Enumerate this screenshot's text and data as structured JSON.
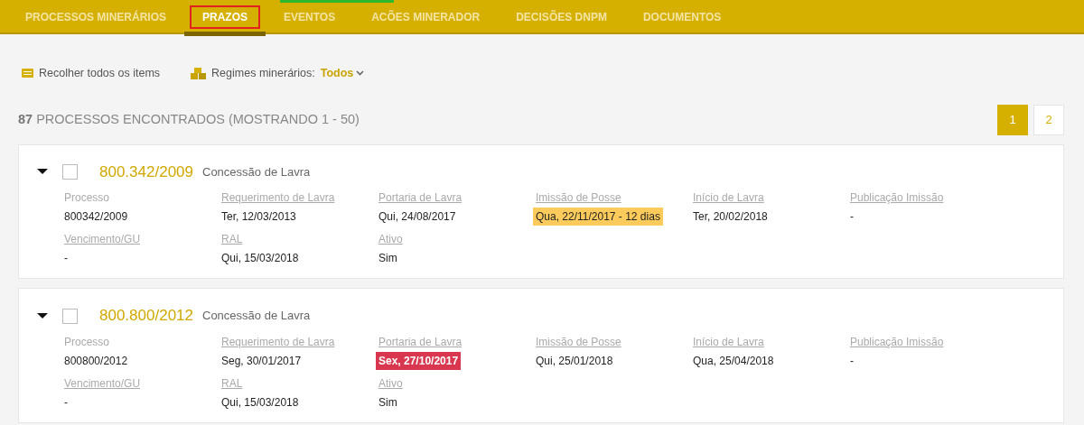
{
  "tabs": [
    {
      "label": "PROCESSOS MINERÁRIOS",
      "selected": false,
      "outlined": false
    },
    {
      "label": "PRAZOS",
      "selected": true,
      "outlined": true
    },
    {
      "label": "EVENTOS",
      "selected": false,
      "outlined": false
    },
    {
      "label": "ACÕES MINERADOR",
      "selected": false,
      "outlined": false
    },
    {
      "label": "DECISÕES DNPM",
      "selected": false,
      "outlined": false
    },
    {
      "label": "DOCUMENTOS",
      "selected": false,
      "outlined": false
    }
  ],
  "toolbar": {
    "collapse_label": "Recolher todos os items",
    "regimes_label": "Regimes minerários:",
    "regimes_value": "Todos"
  },
  "results": {
    "count": "87",
    "text": "PROCESSOS ENCONTRADOS",
    "range": "(MOSTRANDO 1 - 50)"
  },
  "pagination": [
    {
      "label": "1",
      "selected": true
    },
    {
      "label": "2",
      "selected": false
    }
  ],
  "processes": [
    {
      "number": "800.342/2009",
      "type": "Concessão de Lavra",
      "expanded": true,
      "checked": false,
      "fields": [
        {
          "label": "Processo",
          "link": false,
          "value": "800342/2009",
          "warning": false,
          "overdue": false
        },
        {
          "label": "Requerimento de Lavra",
          "link": true,
          "value": "Ter, 12/03/2013",
          "warning": false,
          "overdue": false
        },
        {
          "label": "Portaria de Lavra",
          "link": true,
          "value": "Qui, 24/08/2017",
          "warning": false,
          "overdue": false
        },
        {
          "label": "Imissão de Posse",
          "link": true,
          "value": "Qua, 22/11/2017 - 12 dias",
          "warning": true,
          "overdue": false
        },
        {
          "label": "Início de Lavra",
          "link": true,
          "value": "Ter, 20/02/2018",
          "warning": false,
          "overdue": false
        },
        {
          "label": "Publicação Imissão",
          "link": true,
          "value": "-",
          "warning": false,
          "overdue": false
        },
        {
          "label": "Vencimento/GU",
          "link": true,
          "value": "-",
          "warning": false,
          "overdue": false
        },
        {
          "label": "RAL",
          "link": true,
          "value": "Qui, 15/03/2018",
          "warning": false,
          "overdue": false
        },
        {
          "label": "Ativo",
          "link": true,
          "value": "Sim",
          "warning": false,
          "overdue": false
        }
      ]
    },
    {
      "number": "800.800/2012",
      "type": "Concessão de Lavra",
      "expanded": true,
      "checked": false,
      "fields": [
        {
          "label": "Processo",
          "link": false,
          "value": "800800/2012",
          "warning": false,
          "overdue": false
        },
        {
          "label": "Requerimento de Lavra",
          "link": true,
          "value": "Seg, 30/01/2017",
          "warning": false,
          "overdue": false
        },
        {
          "label": "Portaria de Lavra",
          "link": true,
          "value": "Sex, 27/10/2017",
          "warning": false,
          "overdue": true
        },
        {
          "label": "Imissão de Posse",
          "link": true,
          "value": "Qui, 25/01/2018",
          "warning": false,
          "overdue": false
        },
        {
          "label": "Início de Lavra",
          "link": true,
          "value": "Qua, 25/04/2018",
          "warning": false,
          "overdue": false
        },
        {
          "label": "Publicação Imissão",
          "link": true,
          "value": "-",
          "warning": false,
          "overdue": false
        },
        {
          "label": "Vencimento/GU",
          "link": true,
          "value": "-",
          "warning": false,
          "overdue": false
        },
        {
          "label": "RAL",
          "link": true,
          "value": "Qui, 15/03/2018",
          "warning": false,
          "overdue": false
        },
        {
          "label": "Ativo",
          "link": true,
          "value": "Sim",
          "warning": false,
          "overdue": false
        }
      ]
    }
  ]
}
